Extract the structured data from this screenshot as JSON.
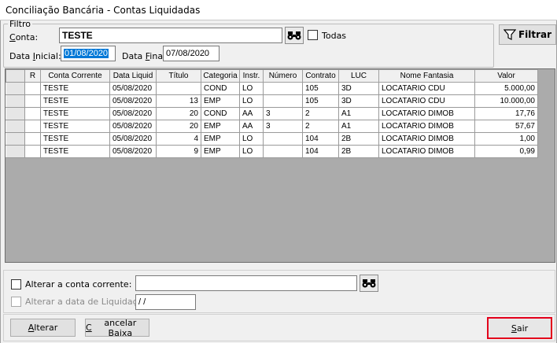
{
  "window": {
    "title": "Conciliação Bancária - Contas Liquidadas"
  },
  "filtro": {
    "legend": "Filtro",
    "conta_label_first": "C",
    "conta_label_rest": "onta:",
    "conta_value": "TESTE",
    "todos_label": "Todas",
    "data_inicial_prefix": "Data ",
    "data_inicial_u": "I",
    "data_inicial_suffix": "nicial:",
    "data_inicial_value": "01/08/2020",
    "data_final_prefix": "Data ",
    "data_final_u": "F",
    "data_final_suffix": "inal:",
    "data_final_value": "07/08/2020",
    "filtrar_label": "Filtrar"
  },
  "grid": {
    "columns": [
      "R",
      "Conta Corrente",
      "Data Liquid",
      "Título",
      "Categoria",
      "Instr.",
      "Número",
      "Contrato",
      "LUC",
      "Nome Fantasia",
      "Valor"
    ],
    "rows": [
      [
        "",
        "TESTE",
        "05/08/2020",
        "",
        "COND",
        "LO",
        "",
        "105",
        "3D",
        "LOCATARIO CDU",
        "5.000,00"
      ],
      [
        "",
        "TESTE",
        "05/08/2020",
        "13",
        "EMP",
        "LO",
        "",
        "105",
        "3D",
        "LOCATARIO CDU",
        "10.000,00"
      ],
      [
        "",
        "TESTE",
        "05/08/2020",
        "20",
        "COND",
        "AA",
        "3",
        "2",
        "A1",
        "LOCATARIO DIMOB",
        "17,76"
      ],
      [
        "",
        "TESTE",
        "05/08/2020",
        "20",
        "EMP",
        "AA",
        "3",
        "2",
        "A1",
        "LOCATARIO DIMOB",
        "57,67"
      ],
      [
        "",
        "TESTE",
        "05/08/2020",
        "4",
        "EMP",
        "LO",
        "",
        "104",
        "2B",
        "LOCATARIO DIMOB",
        "1,00"
      ],
      [
        "",
        "TESTE",
        "05/08/2020",
        "9",
        "EMP",
        "LO",
        "",
        "104",
        "2B",
        "LOCATARIO DIMOB",
        "0,99"
      ]
    ]
  },
  "alterar": {
    "conta_label": "Alterar a conta corrente:",
    "conta_value": "",
    "data_label": "Alterar a data de Liquidação:",
    "data_value": " /  /"
  },
  "buttons": {
    "alterar_u": "A",
    "alterar_rest": "lterar",
    "cancelar_u": "C",
    "cancelar_rest": "ancelar Baixa",
    "sair_u": "S",
    "sair_rest": "air"
  },
  "colors": {
    "highlight": "#0078d7",
    "sair_border": "#e3001b"
  }
}
